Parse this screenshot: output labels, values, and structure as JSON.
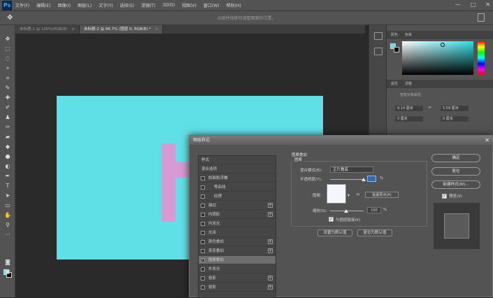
{
  "app": {
    "logo": "Ps"
  },
  "menubar": {
    "items": [
      "文件(F)",
      "编辑(E)",
      "图像(I)",
      "图层(L)",
      "文字(Y)",
      "选择(S)",
      "滤镜(T)",
      "3D(D)",
      "视图(V)",
      "窗口(W)",
      "帮助(H)"
    ],
    "window_buttons": [
      "—",
      "□",
      "✕"
    ]
  },
  "options_bar": {
    "hint": "点按并拖移可调整图案的位置。"
  },
  "tabs": [
    {
      "label": "未标题-1 @ 100%(RGB/8)",
      "close": "×"
    },
    {
      "label": "未标题-2 @ 66.7% (图层 0, RGB/8) *",
      "close": "×"
    }
  ],
  "colors": {
    "canvas": "#5fe0e6",
    "letter": "#d79ad2",
    "foreground": "#5fe0e6"
  },
  "color_panel": {
    "tabs": [
      "颜色",
      "色板"
    ]
  },
  "properties_panel": {
    "tabs": [
      "属性",
      "调整"
    ],
    "title": "智能对象属性",
    "fields": [
      "9.14 厘米",
      "5.59 厘米",
      "0 厘米",
      "0 厘米"
    ],
    "link_symbol": "∞"
  },
  "dialog": {
    "title": "图层样式",
    "close": "✕",
    "styles": [
      {
        "label": "样式",
        "type": "header"
      },
      {
        "label": "混合选项",
        "type": "header"
      },
      {
        "label": "斜面和浮雕",
        "checked": false,
        "plus": false
      },
      {
        "label": "等高线",
        "checked": false,
        "plus": false,
        "indent": true
      },
      {
        "label": "纹理",
        "checked": false,
        "plus": false,
        "indent": true
      },
      {
        "label": "描边",
        "checked": false,
        "plus": true
      },
      {
        "label": "内阴影",
        "checked": false,
        "plus": true
      },
      {
        "label": "内发光",
        "checked": false,
        "plus": false
      },
      {
        "label": "光泽",
        "checked": false,
        "plus": false
      },
      {
        "label": "颜色叠加",
        "checked": false,
        "plus": true
      },
      {
        "label": "渐变叠加",
        "checked": false,
        "plus": true
      },
      {
        "label": "图案叠加",
        "checked": true,
        "plus": false,
        "selected": true
      },
      {
        "label": "外发光",
        "checked": false,
        "plus": false
      },
      {
        "label": "投影",
        "checked": false,
        "plus": true
      },
      {
        "label": "投影",
        "checked": false,
        "plus": true
      }
    ],
    "pattern_overlay": {
      "header": "图案叠加",
      "group": "图案",
      "blend_mode_label": "混合模式(B):",
      "blend_mode_value": "正片叠底",
      "opacity_label": "不透明度(Y):",
      "opacity_unit": "%",
      "pattern_label": "图案:",
      "snap_button": "贴紧原点(A)",
      "scale_label": "缩放(S):",
      "scale_value": "100",
      "scale_unit": "%",
      "link_label": "与图层链接(K)",
      "link_checked": "✓",
      "set_default": "设置为默认值",
      "reset_default": "复位为默认值"
    },
    "buttons": {
      "ok": "确定",
      "reset": "复位",
      "new_style": "新建样式(W)...",
      "preview": "预览(V)",
      "preview_checked": "✓"
    }
  }
}
